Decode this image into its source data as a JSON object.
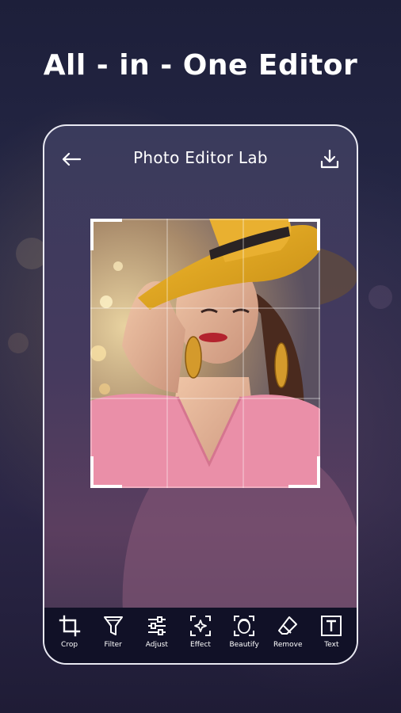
{
  "headline": "All - in - One Editor",
  "app": {
    "title": "Photo Editor Lab",
    "back_icon": "arrow-left-icon",
    "download_icon": "download-icon"
  },
  "toolbar": {
    "items": [
      {
        "label": "Crop",
        "icon": "crop-icon"
      },
      {
        "label": "Filter",
        "icon": "filter-icon"
      },
      {
        "label": "Adjust",
        "icon": "sliders-icon"
      },
      {
        "label": "Effect",
        "icon": "sparkle-effect-icon"
      },
      {
        "label": "Beautify",
        "icon": "face-beautify-icon"
      },
      {
        "label": "Remove",
        "icon": "eraser-icon"
      },
      {
        "label": "Text",
        "icon": "text-icon"
      }
    ]
  },
  "colors": {
    "background": "#1f2140",
    "toolbar": "#111127",
    "hat": "#e3a724",
    "blouse": "#ea8fa8",
    "text": "#ffffff"
  }
}
